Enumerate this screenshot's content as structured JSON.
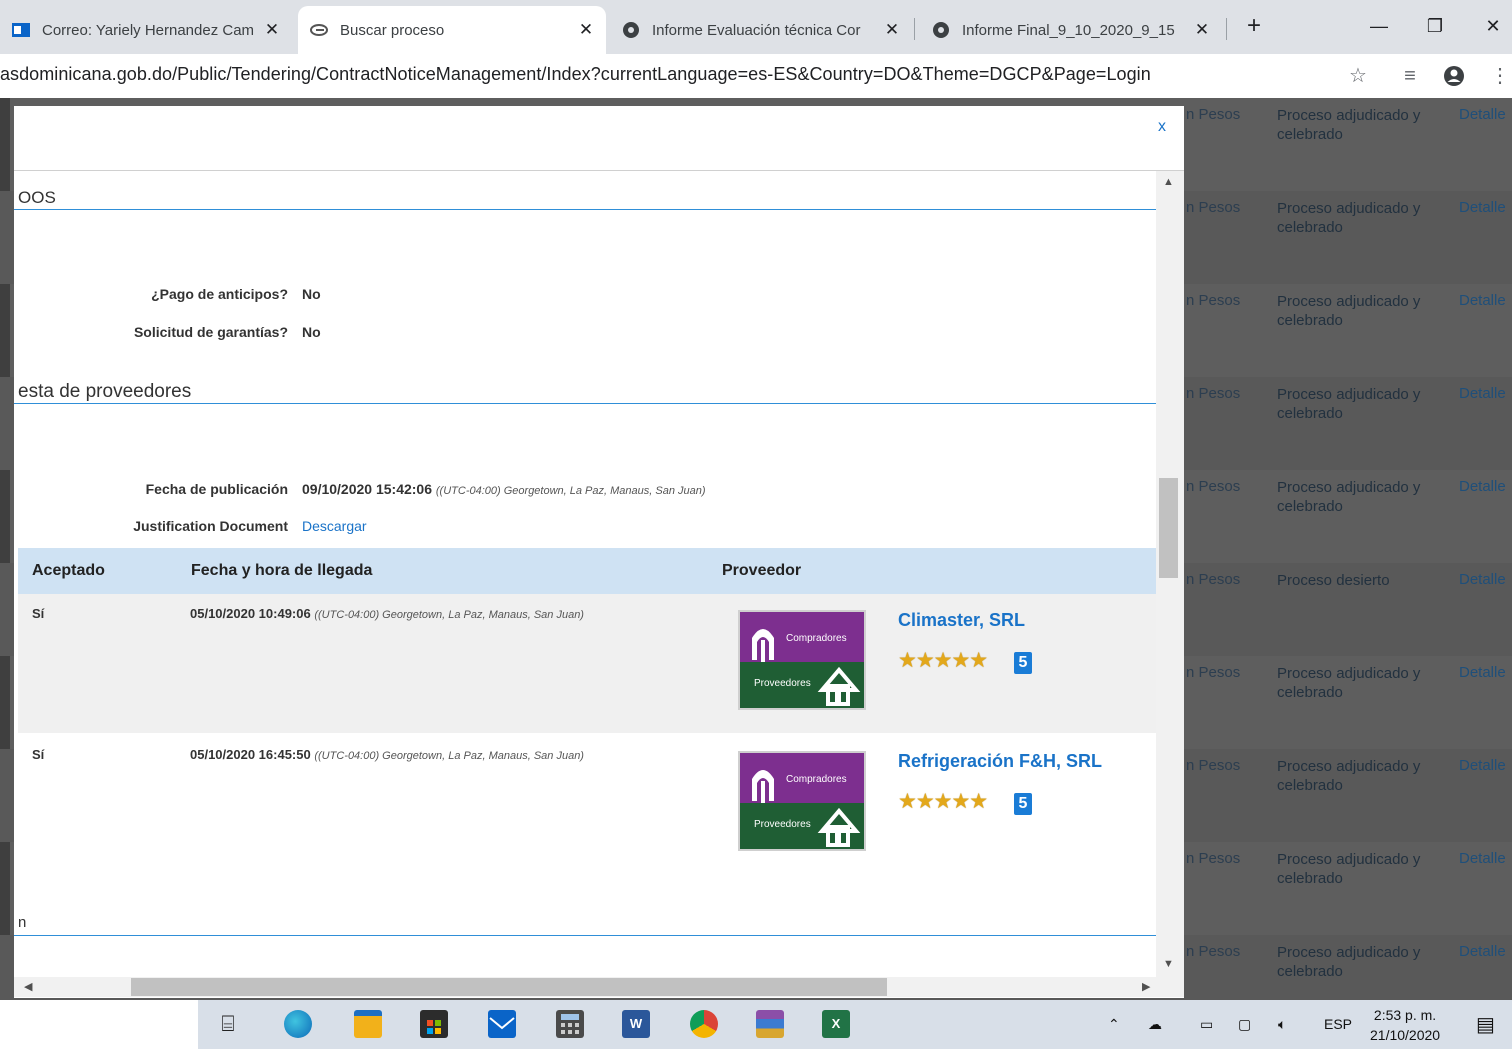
{
  "browser": {
    "tabs": [
      {
        "title": "Correo: Yariely Hernandez Cam",
        "active": false
      },
      {
        "title": "Buscar proceso",
        "active": true
      },
      {
        "title": "Informe Evaluación técnica Cor",
        "active": false
      },
      {
        "title": "Informe Final_9_10_2020_9_15",
        "active": false
      }
    ],
    "url": "asdominicana.gob.do/Public/Tendering/ContractNoticeManagement/Index?currentLanguage=es-ES&Country=DO&Theme=DGCP&Page=Login"
  },
  "background_page": {
    "rows": [
      {
        "currency": "n Pesos",
        "status": "Proceso adjudicado y celebrado",
        "action": "Detalle"
      },
      {
        "currency": "n Pesos",
        "status": "Proceso adjudicado y celebrado",
        "action": "Detalle"
      },
      {
        "currency": "n Pesos",
        "status": "Proceso adjudicado y celebrado",
        "action": "Detalle"
      },
      {
        "currency": "n Pesos",
        "status": "Proceso adjudicado y celebrado",
        "action": "Detalle"
      },
      {
        "currency": "n Pesos",
        "status": "Proceso adjudicado y celebrado",
        "action": "Detalle"
      },
      {
        "currency": "n Pesos",
        "status": "Proceso desierto",
        "action": "Detalle"
      },
      {
        "currency": "n Pesos",
        "status": "Proceso adjudicado y celebrado",
        "action": "Detalle"
      },
      {
        "currency": "n Pesos",
        "status": "Proceso adjudicado y celebrado",
        "action": "Detalle"
      },
      {
        "currency": "n Pesos",
        "status": "Proceso adjudicado y celebrado",
        "action": "Detalle"
      },
      {
        "currency": "n Pesos",
        "status": "Proceso adjudicado y celebrado",
        "action": "Detalle"
      }
    ]
  },
  "modal": {
    "close_label": "x",
    "section1_title": "OOS",
    "advance_payment_label": "¿Pago de anticipos?",
    "advance_payment_value": "No",
    "guarantees_label": "Solicitud de garantías?",
    "guarantees_value": "No",
    "section2_title": "esta de proveedores",
    "publication_label": "Fecha de publicación",
    "publication_date": "09/10/2020 15:42:06",
    "publication_tz": "((UTC-04:00) Georgetown, La Paz, Manaus, San Juan)",
    "justification_label": "Justification Document",
    "justification_link": "Descargar",
    "table": {
      "headers": [
        "Aceptado",
        "Fecha y hora de llegada",
        "Proveedor"
      ],
      "rows": [
        {
          "accepted": "Sí",
          "date": "05/10/2020 10:49:06",
          "tz": "((UTC-04:00) Georgetown, La Paz, Manaus, San Juan)",
          "supplier": "Climaster, SRL",
          "stars": "★★★★★",
          "rating": "5"
        },
        {
          "accepted": "Sí",
          "date": "05/10/2020 16:45:50",
          "tz": "((UTC-04:00) Georgetown, La Paz, Manaus, San Juan)",
          "supplier": "Refrigeración F&H, SRL",
          "stars": "★★★★★",
          "rating": "5"
        }
      ]
    },
    "logo_top": "Compradores",
    "logo_bottom": "Proveedores",
    "section3_title": "n"
  },
  "taskbar": {
    "lang": "ESP",
    "time": "2:53 p. m.",
    "date": "21/10/2020"
  },
  "colors": {
    "accent_link": "#1a73c8",
    "table_header_bg": "#cfe2f3",
    "section_rule": "#2f8fd8",
    "logo_purple": "#7d2f8f",
    "logo_green": "#1f5e34"
  }
}
